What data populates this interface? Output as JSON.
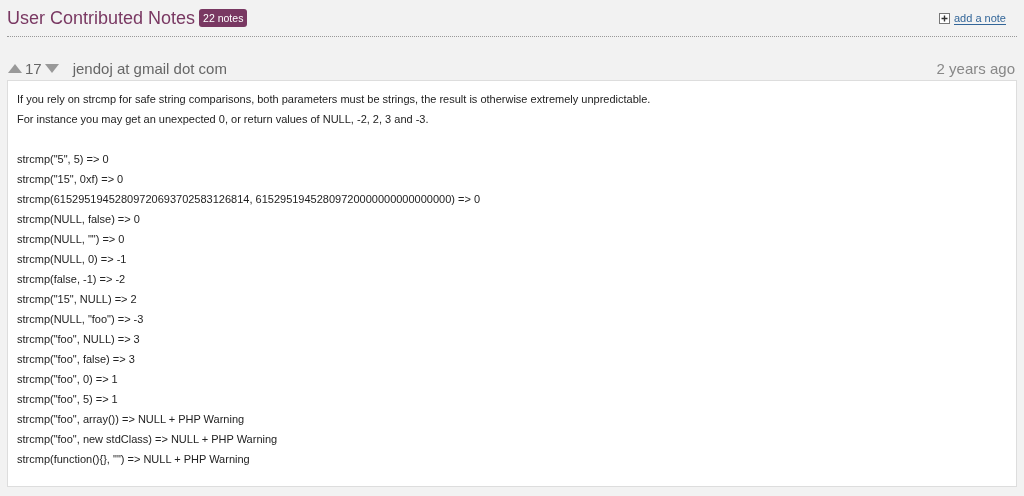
{
  "header": {
    "title": "User Contributed Notes",
    "count_badge": "22 notes",
    "add_link": "add a note"
  },
  "note": {
    "votes": "17",
    "author": "jendoj at gmail dot com",
    "date": "2 years ago",
    "paragraphs": [
      [
        "If you rely on strcmp for safe string comparisons, both parameters must be strings, the result is otherwise extremely unpredictable.",
        "For instance you may get an unexpected 0, or return values of NULL, -2, 2, 3 and -3."
      ],
      [
        "strcmp(\"5\", 5) => 0",
        "strcmp(\"15\", 0xf) => 0",
        "strcmp(61529519452809720693702583126814, 61529519452809720000000000000000) => 0",
        "strcmp(NULL, false) => 0",
        "strcmp(NULL, \"\") => 0",
        "strcmp(NULL, 0) => -1",
        "strcmp(false, -1) => -2",
        "strcmp(\"15\", NULL) => 2",
        "strcmp(NULL, \"foo\") => -3",
        "strcmp(\"foo\", NULL) => 3",
        "strcmp(\"foo\", false) => 3",
        "strcmp(\"foo\", 0) => 1",
        "strcmp(\"foo\", 5) => 1",
        "strcmp(\"foo\", array()) => NULL + PHP Warning",
        "strcmp(\"foo\", new stdClass) => NULL + PHP Warning",
        "strcmp(function(){}, \"\") => NULL + PHP Warning"
      ]
    ]
  }
}
